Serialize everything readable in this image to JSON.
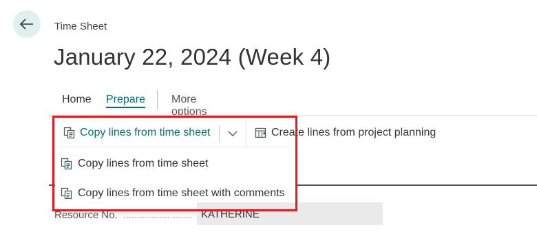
{
  "header": {
    "back_icon": "arrow-left-icon",
    "caption": "Time Sheet",
    "title": "January 22, 2024 (Week 4)"
  },
  "tabs": [
    {
      "label": "Home",
      "active": false
    },
    {
      "label": "Prepare",
      "active": true
    },
    {
      "label": "More options",
      "active": false
    }
  ],
  "toolbar": {
    "copy_split_label": "Copy lines from time sheet",
    "copy_icon": "copy-lines-icon",
    "chevron_icon": "chevron-down-icon",
    "create_label": "Create lines from project planning",
    "create_icon": "create-lines-icon"
  },
  "dropdown": {
    "items": [
      {
        "label": "Copy lines from time sheet",
        "icon": "copy-lines-icon"
      },
      {
        "label": "Copy lines from time sheet with comments",
        "icon": "copy-lines-icon"
      }
    ]
  },
  "field": {
    "label": "Resource No.",
    "value": "KATHERINE"
  },
  "colors": {
    "accent": "#00707a",
    "highlight": "#e21b23",
    "back_button_bg": "#dff0ee"
  }
}
